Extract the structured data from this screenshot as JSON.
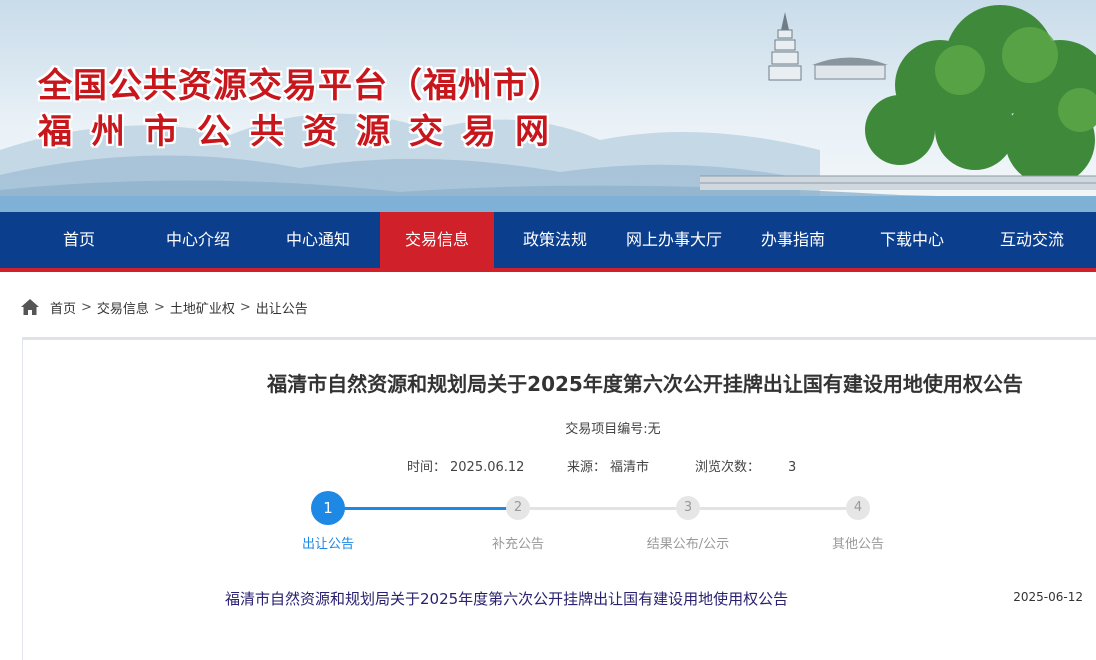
{
  "header": {
    "title_line1": "全国公共资源交易平台（福州市）",
    "title_line2": "福州市公共资源交易网"
  },
  "nav": {
    "items": [
      {
        "label": "首页"
      },
      {
        "label": "中心介绍"
      },
      {
        "label": "中心通知"
      },
      {
        "label": "交易信息",
        "active": true
      },
      {
        "label": "政策法规"
      },
      {
        "label": "网上办事大厅"
      },
      {
        "label": "办事指南"
      },
      {
        "label": "下载中心"
      },
      {
        "label": "互动交流"
      }
    ]
  },
  "breadcrumb": {
    "items": [
      "首页",
      "交易信息",
      "土地矿业权",
      "出让公告"
    ],
    "separator": ">"
  },
  "article": {
    "title": "福清市自然资源和规划局关于2025年度第六次公开挂牌出让国有建设用地使用权公告",
    "project_no": "交易项目编号:无",
    "time_label": "时间：",
    "time_value": "2025.06.12",
    "source_label": "来源：",
    "source_value": "福清市",
    "views_label": "浏览次数：",
    "views_value": "3"
  },
  "steps": {
    "current": 1,
    "items": [
      {
        "num": "1",
        "label": "出让公告"
      },
      {
        "num": "2",
        "label": "补充公告"
      },
      {
        "num": "3",
        "label": "结果公布/公示"
      },
      {
        "num": "4",
        "label": "其他公告"
      }
    ]
  },
  "list": [
    {
      "title": "福清市自然资源和规划局关于2025年度第六次公开挂牌出让国有建设用地使用权公告",
      "date": "2025-06-12"
    }
  ],
  "colors": {
    "nav_bg": "#0b3f8e",
    "accent_red": "#d0202a",
    "step_active": "#1e88e5",
    "title_red": "#c8161d"
  }
}
